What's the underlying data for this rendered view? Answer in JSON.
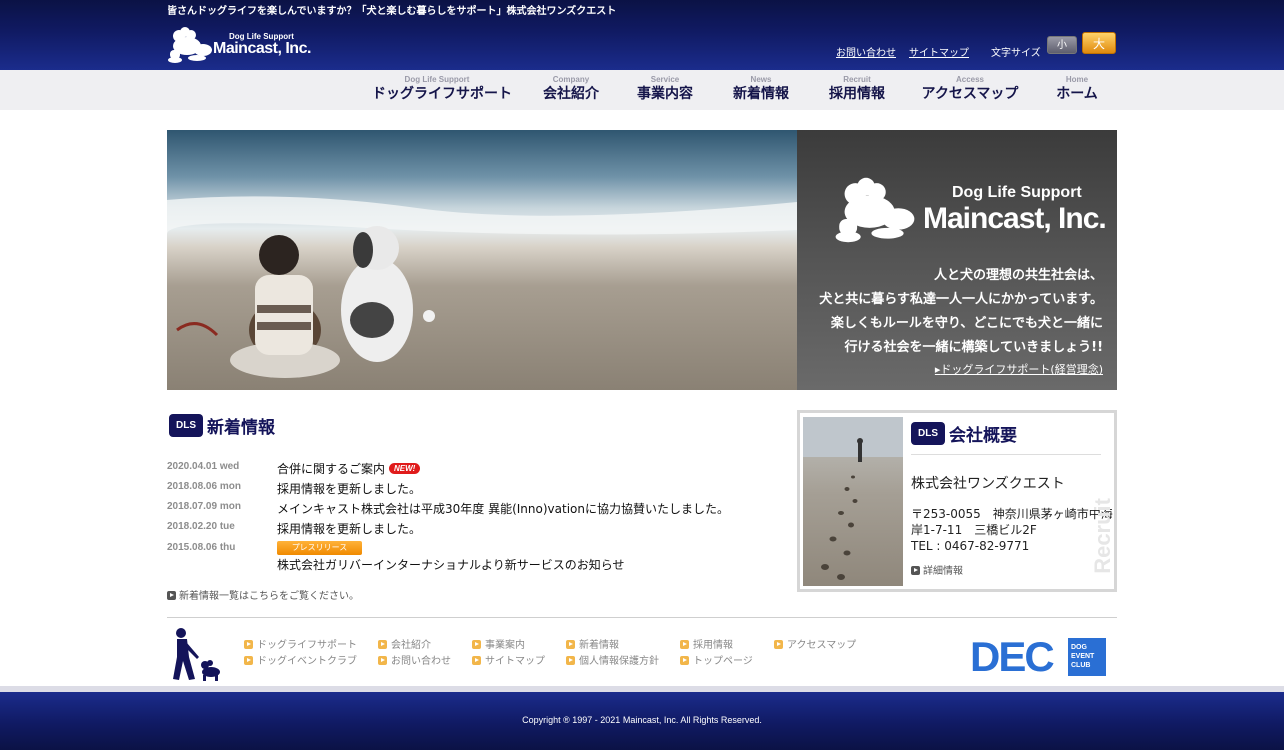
{
  "header": {
    "tagline": "皆さんドッグライフを楽しんでいますか？「犬と楽しむ暮らしをサポート」株式会社ワンズクエスト",
    "logo_small": "Dog Life Support",
    "logo_big": "Maincast, Inc.",
    "contact_link": "お問い合わせ",
    "sitemap_link": "サイトマップ",
    "font_size_label": "文字サイズ",
    "font_small": "小",
    "font_large": "大"
  },
  "nav": {
    "items": [
      {
        "en": "Dog Life Support",
        "jp": "ドッグライフサポート"
      },
      {
        "en": "Company",
        "jp": "会社紹介"
      },
      {
        "en": "Service",
        "jp": "事業内容"
      },
      {
        "en": "News",
        "jp": "新着情報"
      },
      {
        "en": "Recruit",
        "jp": "採用情報"
      },
      {
        "en": "Access",
        "jp": "アクセスマップ"
      },
      {
        "en": "Home",
        "jp": "ホーム"
      }
    ]
  },
  "hero": {
    "brand_small": "Dog Life Support",
    "brand_big": "Maincast, Inc.",
    "copy": [
      "人と犬の理想の共生社会は、",
      "犬と共に暮らす私達一人一人にかかっています。",
      "楽しくもルールを守り、どこにでも犬と一緒に",
      "行ける社会を一緒に構築していきましょう!!"
    ],
    "link": "ドッグライフサポート(経営理念)"
  },
  "news": {
    "badge": "DLS",
    "title": "新着情報",
    "new_label": "NEW!",
    "items": [
      {
        "date": "2020.04.01 wed",
        "text": "合併に関するご案内"
      },
      {
        "date": "2018.08.06 mon",
        "text": "採用情報を更新しました。"
      },
      {
        "date": "2018.07.09 mon",
        "text": "メインキャスト株式会社は平成30年度 異能(Inno)vationに協力協賛いたしました。"
      },
      {
        "date": "2018.02.20 tue",
        "text": "採用情報を更新しました。"
      },
      {
        "date": "2015.08.06 thu",
        "badge": "プレスリリース",
        "text": "株式会社ガリバーインターナショナルより新サービスのお知らせ"
      }
    ],
    "more": "新着情報一覧はこちらをご覧ください。"
  },
  "company": {
    "badge": "DLS",
    "title": "会社概要",
    "name": "株式会社ワンズクエスト",
    "postal": "〒253-0055　神奈川県茅ヶ崎市中海岸1-7-11　三橋ビル2F",
    "tel": "TEL : 0467-82-9771",
    "link": "詳細情報",
    "watermark": "Recruit"
  },
  "footer": {
    "links_row1": [
      "ドッグライフサポート",
      "会社紹介",
      "事業案内",
      "新着情報",
      "採用情報",
      "アクセスマップ"
    ],
    "links_row2": [
      "ドッグイベントクラブ",
      "お問い合わせ",
      "サイトマップ",
      "個人情報保護方針",
      "トップページ"
    ],
    "dec_big": "DEC",
    "dec_sub": [
      "DOG",
      "EVENT",
      "CLUB"
    ],
    "copyright": "Copyright ® 1997 - 2021 Maincast, Inc. All Rights Reserved."
  },
  "colors": {
    "header_navy": "#101a63",
    "accent_orange": "#f08a00",
    "dec_blue": "#2a6fd4"
  }
}
